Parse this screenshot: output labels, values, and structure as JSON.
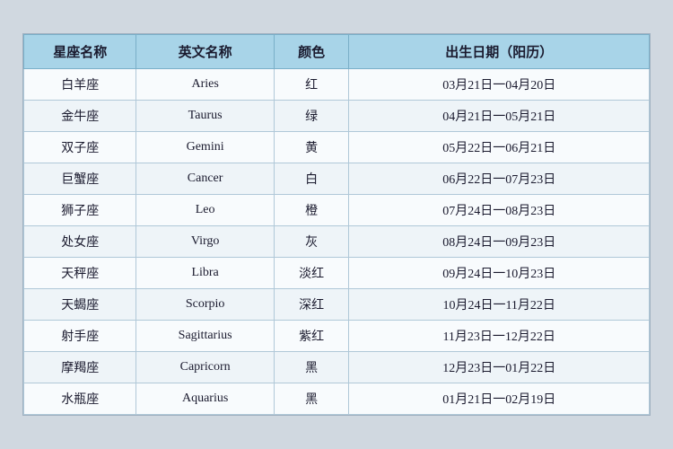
{
  "table": {
    "headers": {
      "chinese_name": "星座名称",
      "english_name": "英文名称",
      "color": "颜色",
      "birth_date": "出生日期（阳历）"
    },
    "rows": [
      {
        "chinese": "白羊座",
        "english": "Aries",
        "color": "红",
        "dates": "03月21日一04月20日"
      },
      {
        "chinese": "金牛座",
        "english": "Taurus",
        "color": "绿",
        "dates": "04月21日一05月21日"
      },
      {
        "chinese": "双子座",
        "english": "Gemini",
        "color": "黄",
        "dates": "05月22日一06月21日"
      },
      {
        "chinese": "巨蟹座",
        "english": "Cancer",
        "color": "白",
        "dates": "06月22日一07月23日"
      },
      {
        "chinese": "狮子座",
        "english": "Leo",
        "color": "橙",
        "dates": "07月24日一08月23日"
      },
      {
        "chinese": "处女座",
        "english": "Virgo",
        "color": "灰",
        "dates": "08月24日一09月23日"
      },
      {
        "chinese": "天秤座",
        "english": "Libra",
        "color": "淡红",
        "dates": "09月24日一10月23日"
      },
      {
        "chinese": "天蝎座",
        "english": "Scorpio",
        "color": "深红",
        "dates": "10月24日一11月22日"
      },
      {
        "chinese": "射手座",
        "english": "Sagittarius",
        "color": "紫红",
        "dates": "11月23日一12月22日"
      },
      {
        "chinese": "摩羯座",
        "english": "Capricorn",
        "color": "黑",
        "dates": "12月23日一01月22日"
      },
      {
        "chinese": "水瓶座",
        "english": "Aquarius",
        "color": "黑",
        "dates": "01月21日一02月19日"
      }
    ]
  }
}
